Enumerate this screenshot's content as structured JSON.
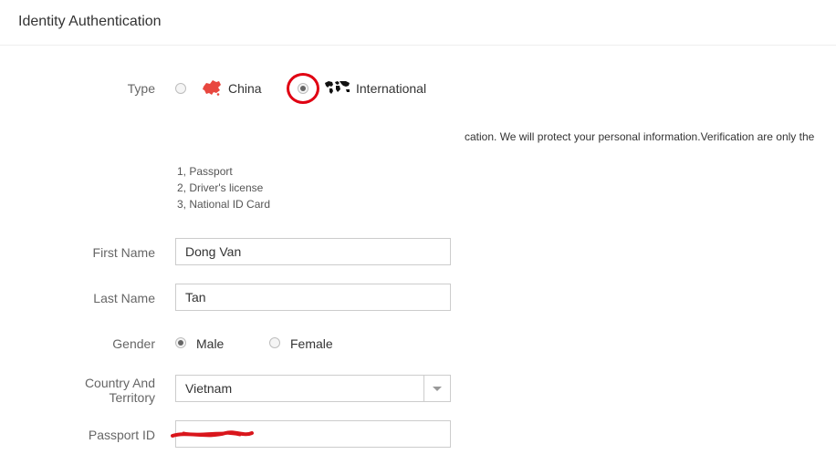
{
  "header": {
    "title": "Identity Authentication"
  },
  "type": {
    "label": "Type",
    "options": [
      {
        "label": "China",
        "selected": false,
        "icon": "china-map-icon"
      },
      {
        "label": "International",
        "selected": true,
        "icon": "world-map-icon"
      }
    ]
  },
  "notice": "cation. We will protect your personal information.Verification are only the",
  "documents": [
    "1, Passport",
    "2, Driver's license",
    "3, National ID Card"
  ],
  "form": {
    "first_name": {
      "label": "First Name",
      "value": "Dong Van"
    },
    "last_name": {
      "label": "Last Name",
      "value": "Tan"
    },
    "gender": {
      "label": "Gender",
      "options": [
        {
          "label": "Male",
          "selected": true
        },
        {
          "label": "Female",
          "selected": false
        }
      ]
    },
    "country": {
      "label_line1": "Country And",
      "label_line2": "Territory",
      "value": "Vietnam"
    },
    "passport": {
      "label": "Passport ID",
      "value": ""
    }
  },
  "colors": {
    "china_icon": "#e8473f",
    "highlight_ring": "#e00012",
    "redaction": "#d9161c"
  }
}
